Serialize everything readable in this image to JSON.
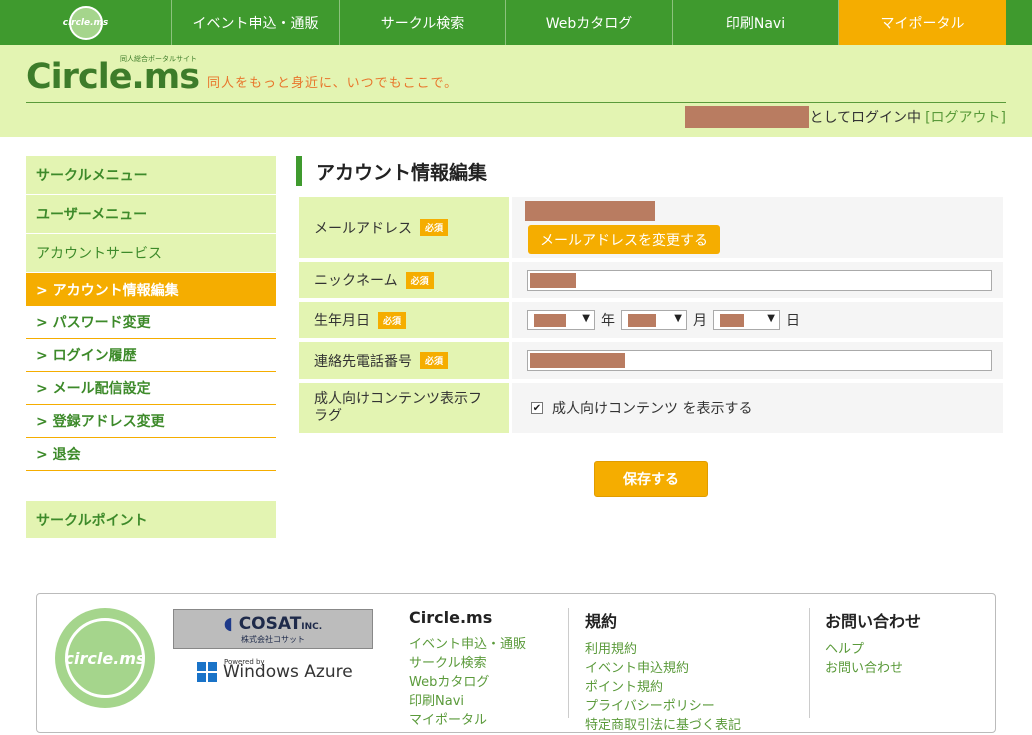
{
  "topnav": {
    "home_logo": "circle.ms",
    "items": [
      {
        "label": "イベント申込・通販"
      },
      {
        "label": "サークル検索"
      },
      {
        "label": "Webカタログ"
      },
      {
        "label": "印刷Navi"
      },
      {
        "label": "マイポータル"
      }
    ]
  },
  "header": {
    "logo": "Circle.ms",
    "logo_sub": "同人総合ポータルサイト",
    "tagline": "同人をもっと身近に、いつでもここで。",
    "login_text": "としてログイン中",
    "logout_label": "[ログアウト]"
  },
  "sidebar": {
    "heads": [
      "サークルメニュー",
      "ユーザーメニュー",
      "アカウントサービス"
    ],
    "items": [
      {
        "label": "> アカウント情報編集"
      },
      {
        "label": "> パスワード変更"
      },
      {
        "label": "> ログイン履歴"
      },
      {
        "label": "> メール配信設定"
      },
      {
        "label": "> 登録アドレス変更"
      },
      {
        "label": "> 退会"
      }
    ],
    "point": "サークルポイント"
  },
  "main": {
    "title": "アカウント情報編集",
    "required_badge": "必須",
    "fields": {
      "email_label": "メールアドレス",
      "change_email_button": "メールアドレスを変更する",
      "nickname_label": "ニックネーム",
      "birthday_label": "生年月日",
      "year_unit": "年",
      "month_unit": "月",
      "day_unit": "日",
      "phone_label": "連絡先電話番号",
      "adult_label": "成人向けコンテンツ表示フラグ",
      "adult_checkbox_label": "成人向けコンテンツ を表示する"
    },
    "save_button": "保存する"
  },
  "footer": {
    "logo": "circle.ms",
    "cosat_name": "COSAT",
    "cosat_inc": "INC.",
    "cosat_jp": "株式会社コサット",
    "azure_powered": "Powered by",
    "azure_name": "Windows Azure",
    "columns": [
      {
        "heading": "Circle.ms",
        "links": [
          "イベント申込・通販",
          "サークル検索",
          "Webカタログ",
          "印刷Navi",
          "マイポータル"
        ]
      },
      {
        "heading": "規約",
        "links": [
          "利用規約",
          "イベント申込規約",
          "ポイント規約",
          "プライバシーポリシー",
          "特定商取引法に基づく表記"
        ]
      },
      {
        "heading": "お問い合わせ",
        "links": [
          "ヘルプ",
          "お問い合わせ"
        ]
      }
    ]
  }
}
